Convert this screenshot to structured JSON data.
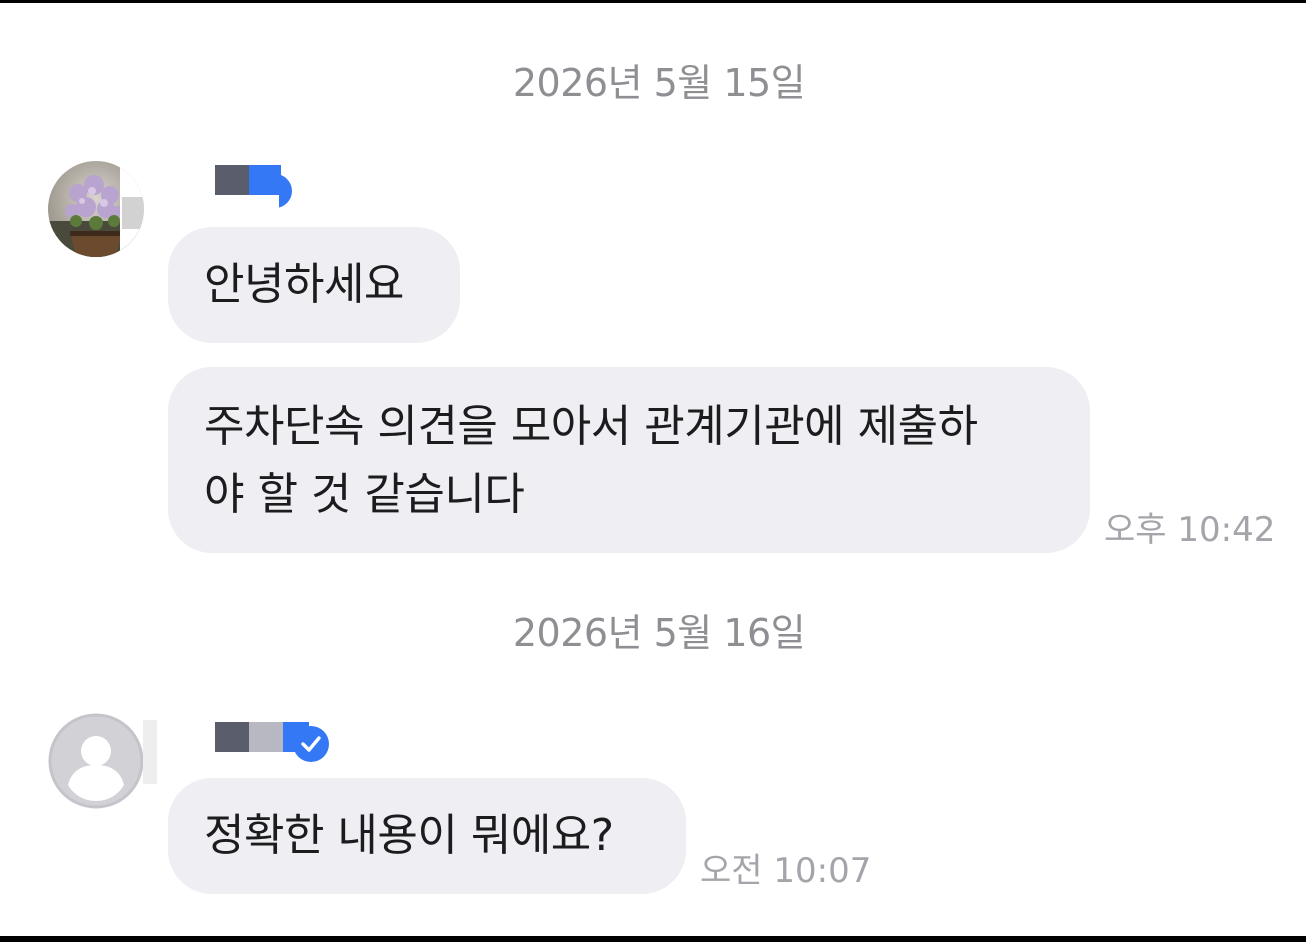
{
  "chat": {
    "dates": {
      "first": "2026년 5월 15일",
      "second": "2026년 5월 16일"
    },
    "messages": [
      {
        "sender_avatar": "flower-photo",
        "sender_verified": true,
        "bubbles": [
          {
            "text": "안녕하세요"
          },
          {
            "text_line1": "주차단속 의견을 모아서 관계기관에 제출하",
            "text_line2": "야 할 것 같습니다"
          }
        ],
        "time": "오후 10:42"
      },
      {
        "sender_avatar": "default-person-icon",
        "sender_verified": true,
        "bubbles": [
          {
            "text": "정확한 내용이 뭐에요?"
          }
        ],
        "time": "오전 10:07"
      }
    ]
  },
  "colors": {
    "bubble_bg": "#eeeef3",
    "verified_blue": "#3478f6",
    "date_text": "#8e8e93",
    "time_text": "#a4a4aa",
    "name_redaction_dark": "#5a5d6b",
    "name_redaction_light": "#b7b8c2"
  }
}
